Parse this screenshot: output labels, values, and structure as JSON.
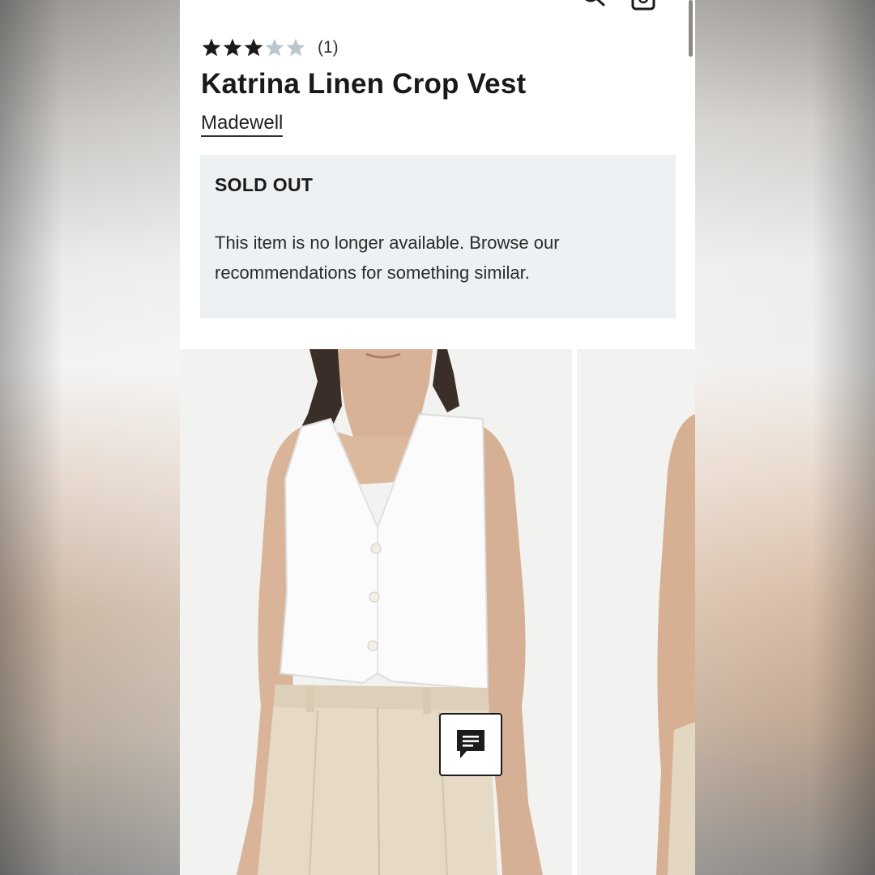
{
  "product": {
    "rating": 3,
    "rating_max": 5,
    "review_count": "(1)",
    "title": "Katrina Linen Crop Vest",
    "brand": "Madewell"
  },
  "availability": {
    "status": "SOLD OUT",
    "message": "This item is no longer available. Browse our recommendations for something similar."
  },
  "colors": {
    "star_filled": "#1a1a1a",
    "star_empty": "#bcc6cc",
    "notice_bg": "#edf1f4"
  },
  "icons": [
    "menu-icon",
    "search-icon",
    "bag-icon",
    "star-icon",
    "chat-icon"
  ]
}
